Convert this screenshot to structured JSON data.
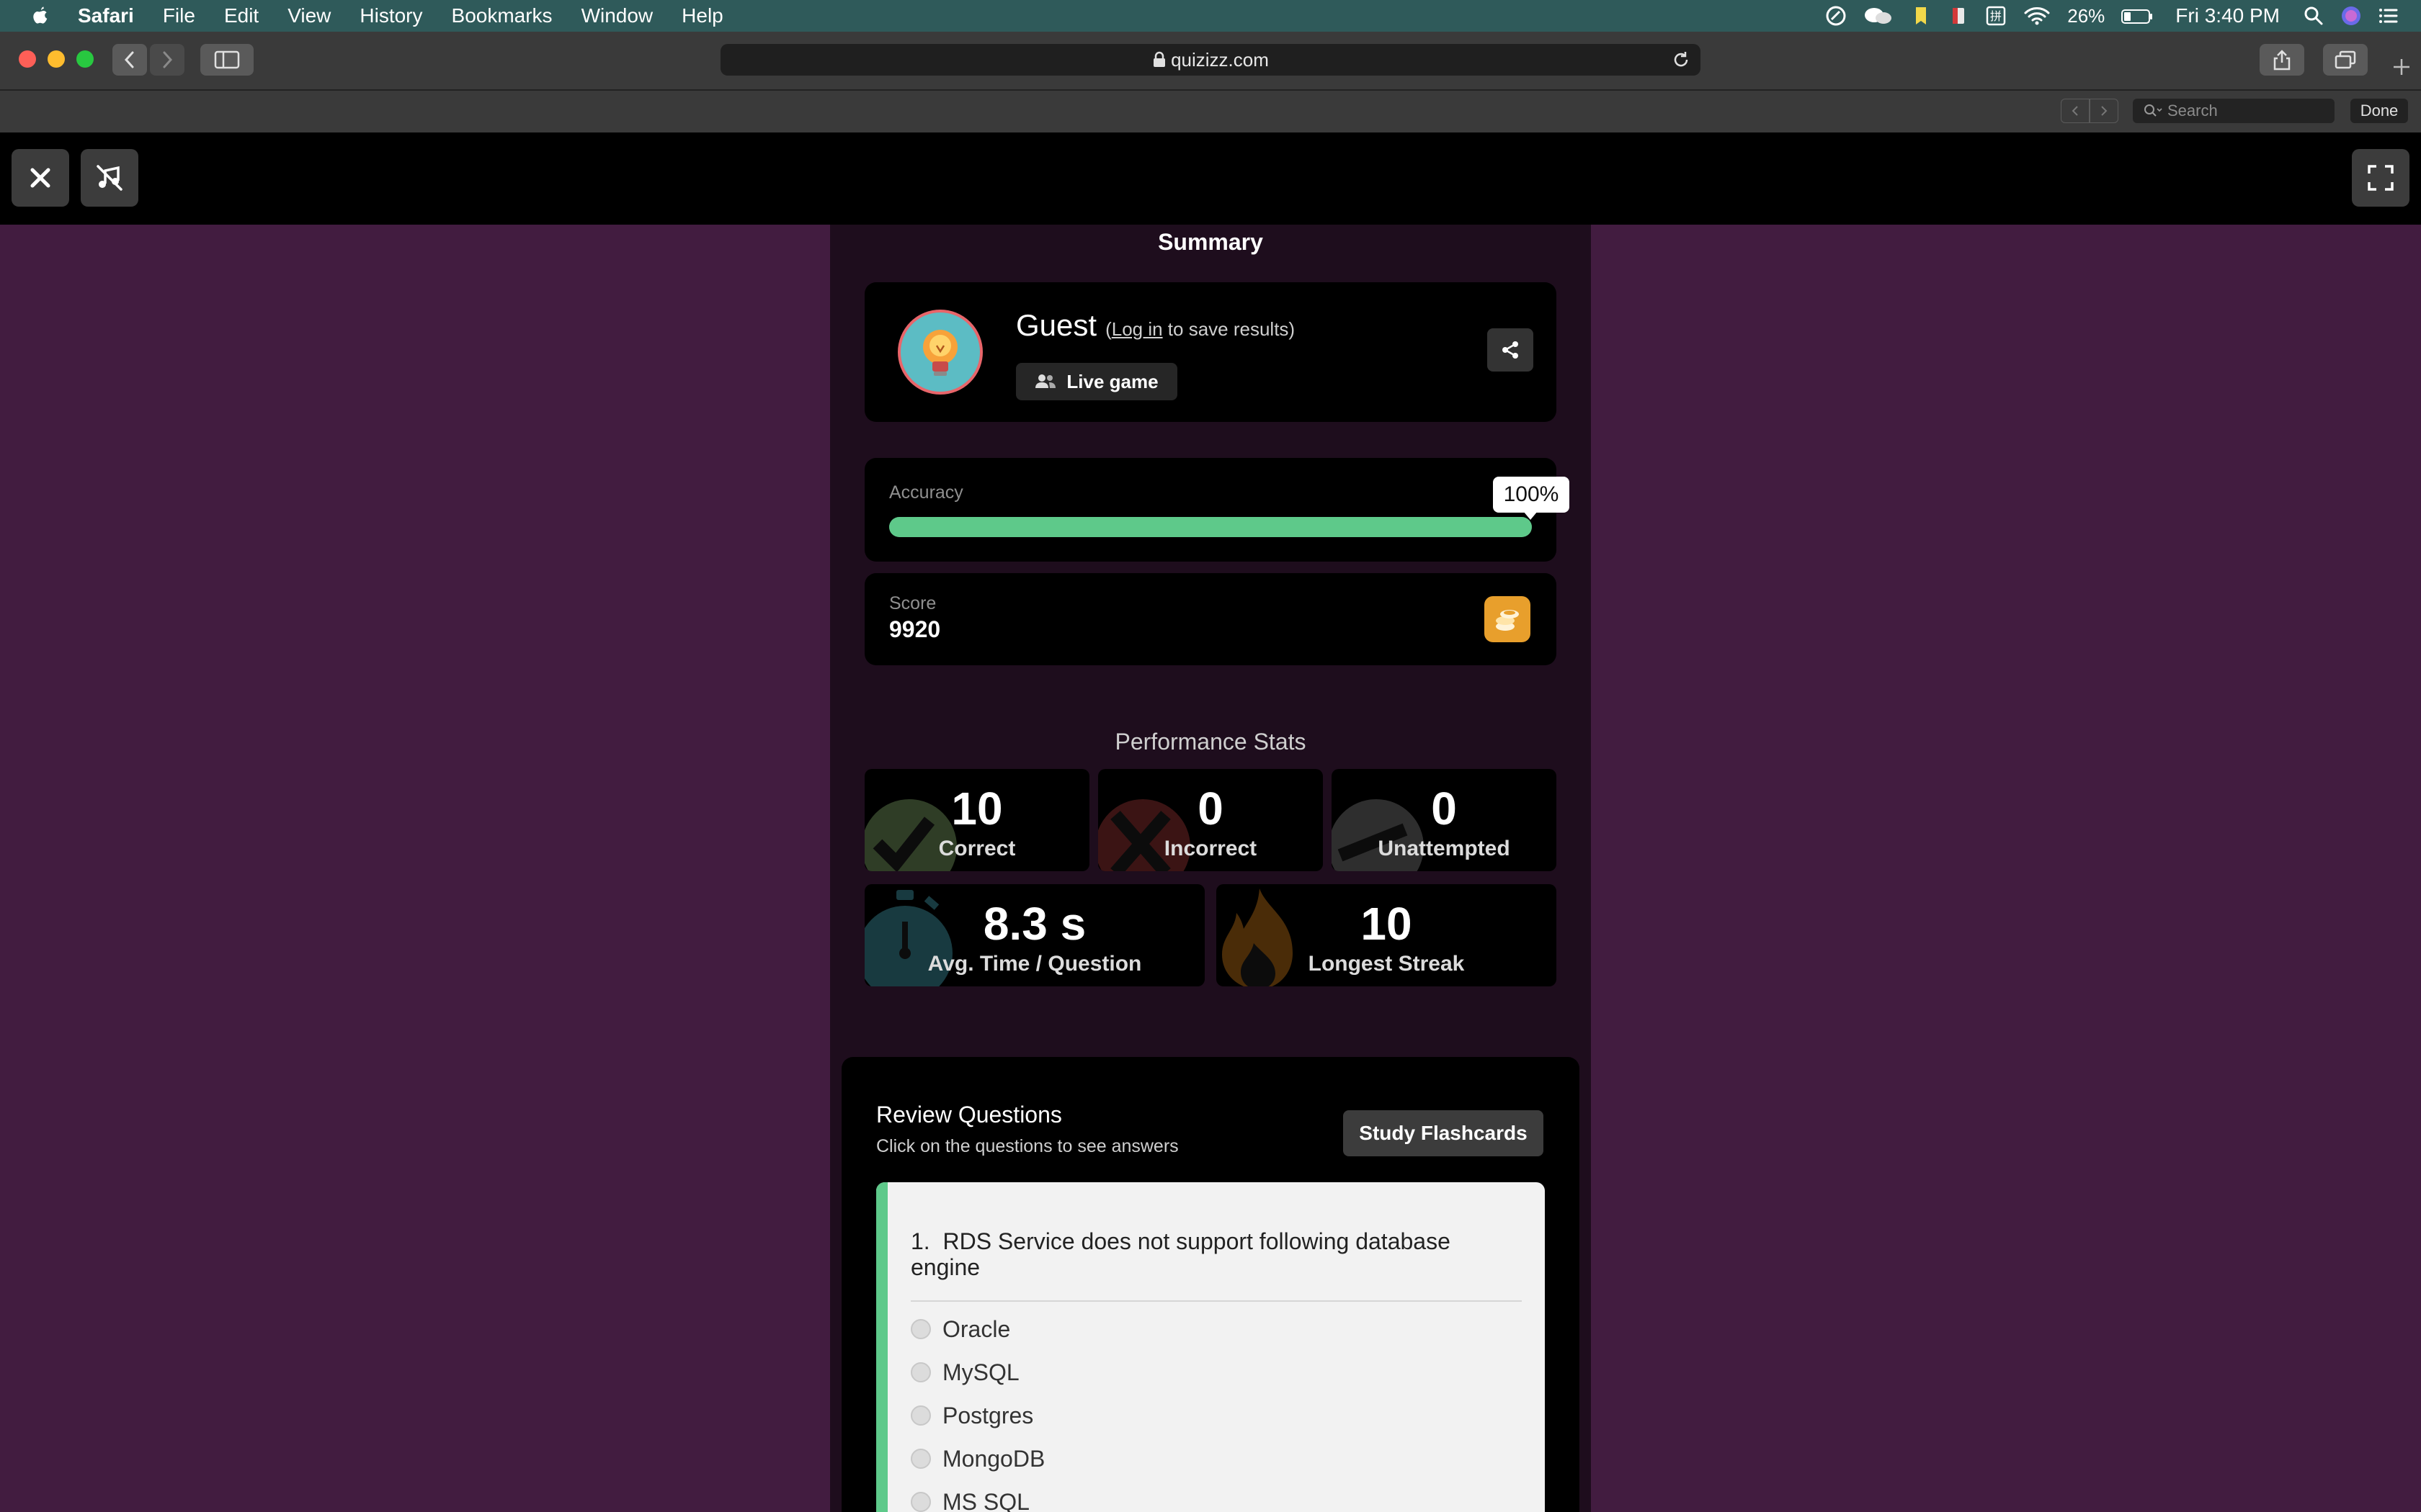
{
  "menubar": {
    "app": "Safari",
    "items": [
      "File",
      "Edit",
      "View",
      "History",
      "Bookmarks",
      "Window",
      "Help"
    ],
    "battery": "26%",
    "clock": "Fri 3:40 PM"
  },
  "browser": {
    "url": "quizizz.com",
    "find_placeholder": "Search",
    "done_label": "Done"
  },
  "summary": {
    "title": "Summary",
    "user_name": "Guest",
    "login_prefix": "(",
    "login_link": "Log in",
    "login_suffix": " to save results)",
    "game_mode": "Live game"
  },
  "accuracy": {
    "label": "Accuracy",
    "value_text": "100%",
    "fraction": 1.0
  },
  "score": {
    "label": "Score",
    "value": "9920"
  },
  "performance": {
    "title": "Performance Stats",
    "correct": {
      "value": "10",
      "label": "Correct"
    },
    "incorrect": {
      "value": "0",
      "label": "Incorrect"
    },
    "unattempted": {
      "value": "0",
      "label": "Unattempted"
    },
    "avg_time": {
      "value": "8.3 s",
      "label": "Avg. Time / Question"
    },
    "streak": {
      "value": "10",
      "label": "Longest Streak"
    }
  },
  "review": {
    "title": "Review Questions",
    "subtitle": "Click on the questions to see answers",
    "flashcards_label": "Study Flashcards",
    "question": {
      "number": "1.",
      "text": "RDS Service does not support following database engine",
      "options": [
        "Oracle",
        "MySQL",
        "Postgres",
        "MongoDB",
        "MS SQL"
      ]
    }
  },
  "colors": {
    "background": "#421c40",
    "accuracy_bar": "#5ec98a",
    "correct_green": "#2f3d26",
    "incorrect_red": "#3b1414",
    "timer_teal": "#183a40",
    "streak_orange": "#4a2c08"
  }
}
